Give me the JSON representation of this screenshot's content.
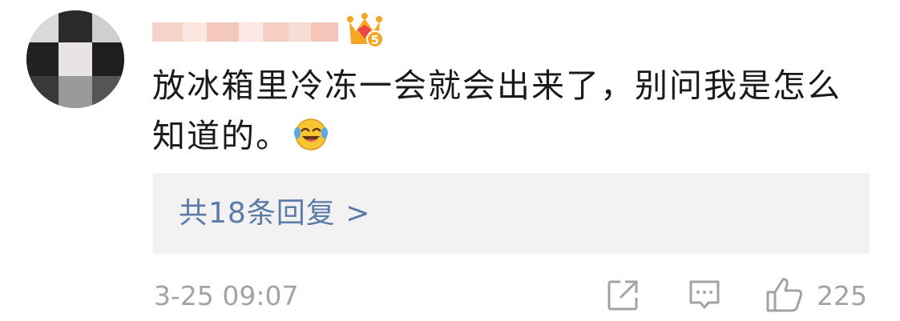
{
  "comment": {
    "avatar_icon": "user-avatar-pixelated",
    "username_icon": "pixelated-username",
    "badge_icon": "vip-crown-badge-icon",
    "badge_level": "5",
    "text": "放冰箱里冷冻一会就会出来了，别问我是怎么知道的。",
    "emoji_icon": "laughing-crying-emoji-icon"
  },
  "replies": {
    "label": "共18条回复 >"
  },
  "footer": {
    "timestamp": "3-25 09:07",
    "share_icon": "share-icon",
    "comment_icon": "comment-icon",
    "like_icon": "thumbs-up-icon",
    "like_count": "225"
  },
  "colors": {
    "text": "#1a1a1a",
    "link": "#5b7ba8",
    "meta": "#a3a3a3",
    "reply_bg": "#f2f2f2",
    "badge_gold": "#f5a623",
    "badge_red": "#e8444a"
  }
}
